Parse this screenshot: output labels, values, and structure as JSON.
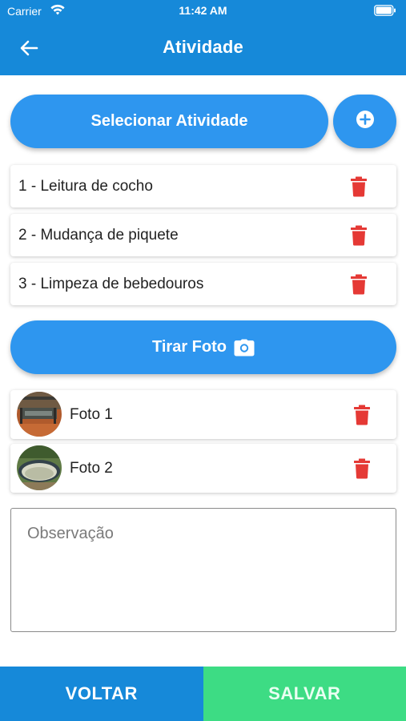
{
  "status_bar": {
    "carrier": "Carrier",
    "time": "11:42 AM"
  },
  "app_bar": {
    "title": "Atividade",
    "back_icon": "arrow-left-icon"
  },
  "activities": {
    "select_label": "Selecionar Atividade",
    "add_icon": "plus-circle-icon",
    "items": [
      {
        "label": "1 - Leitura de cocho"
      },
      {
        "label": "2 - Mudança de piquete"
      },
      {
        "label": "3 - Limpeza de bebedouros"
      }
    ]
  },
  "photos": {
    "take_photo_label": "Tirar Foto",
    "camera_icon": "camera-icon",
    "items": [
      {
        "label": "Foto 1"
      },
      {
        "label": "Foto 2"
      }
    ]
  },
  "observation": {
    "placeholder": "Observação"
  },
  "footer": {
    "back_label": "VOLTAR",
    "save_label": "SALVAR"
  },
  "colors": {
    "primary": "#1689d9",
    "button": "#2e96ef",
    "delete": "#e53935",
    "save": "#3ddc84"
  }
}
